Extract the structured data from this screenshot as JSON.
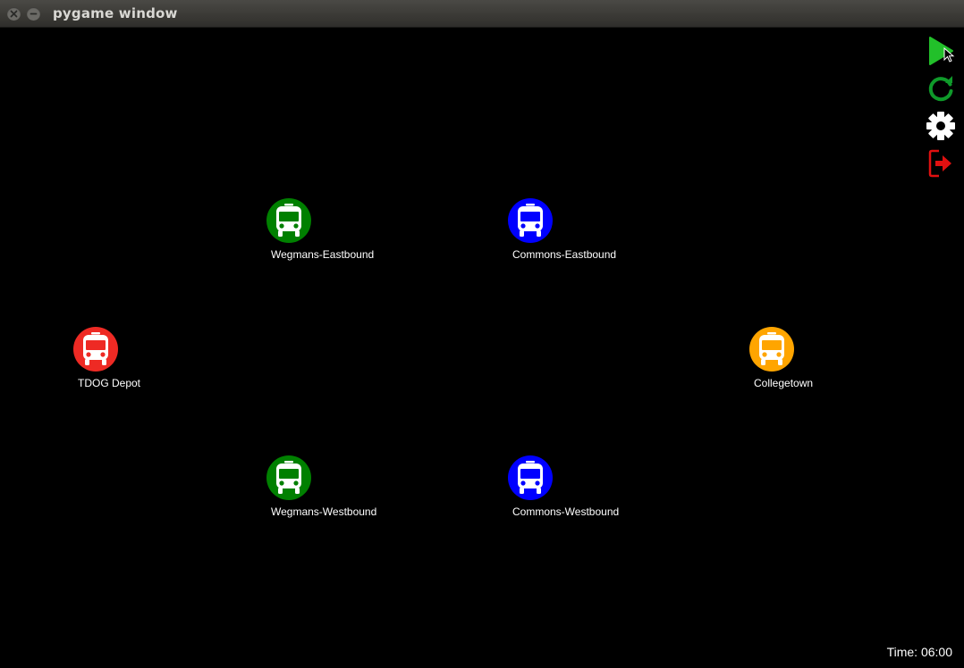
{
  "window": {
    "title": "pygame window"
  },
  "stops": [
    {
      "id": "wegmans-eastbound",
      "name": "Wegmans-Eastbound",
      "color": "#008000"
    },
    {
      "id": "commons-eastbound",
      "name": "Commons-Eastbound",
      "color": "#0000ff"
    },
    {
      "id": "tdog-depot",
      "name": "TDOG Depot",
      "color": "#ee2a24"
    },
    {
      "id": "collegetown",
      "name": "Collegetown",
      "color": "#ffa500"
    },
    {
      "id": "wegmans-westbound",
      "name": "Wegmans-Westbound",
      "color": "#008000"
    },
    {
      "id": "commons-westbound",
      "name": "Commons-Westbound",
      "color": "#0000ff"
    }
  ],
  "toolbar": [
    {
      "icon": "play-icon",
      "color": "#22c02a"
    },
    {
      "icon": "restart-icon",
      "color": "#0f9a2a"
    },
    {
      "icon": "gear-icon",
      "color": "#ffffff"
    },
    {
      "icon": "exit-icon",
      "color": "#e01010"
    }
  ],
  "status": {
    "time": "Time: 06:00"
  }
}
